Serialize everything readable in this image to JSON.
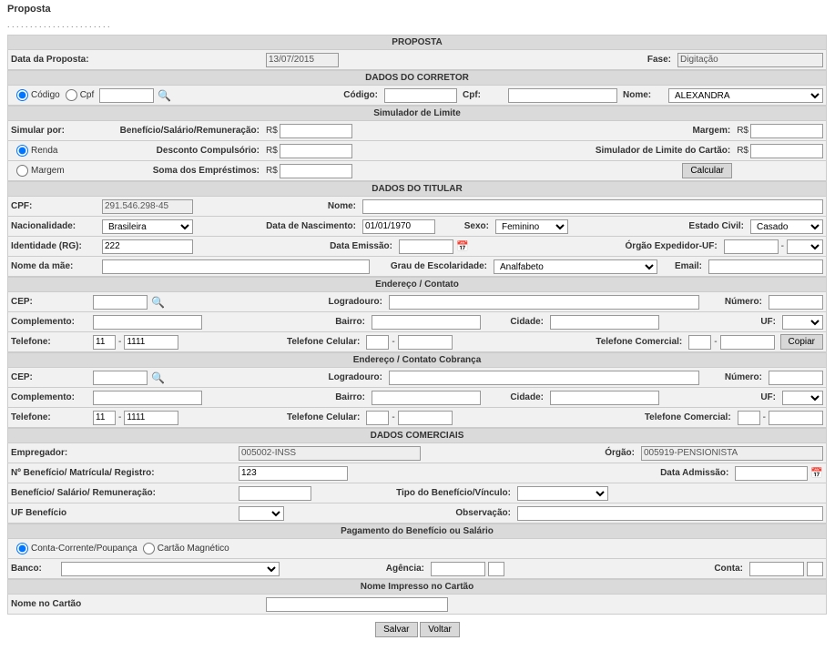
{
  "page": {
    "title": "Proposta",
    "breadcrumb": ". . . . . . . . . . . . . . . . . . . . . . ."
  },
  "proposta": {
    "header": "PROPOSTA",
    "data_label": "Data da Proposta:",
    "data_value": "13/07/2015",
    "fase_label": "Fase:",
    "fase_value": "Digitação"
  },
  "corretor": {
    "header": "DADOS DO CORRETOR",
    "radio_codigo": "Código",
    "radio_cpf": "Cpf",
    "codigo_label": "Código:",
    "codigo_value": "",
    "cpf_label": "Cpf:",
    "cpf_value": "",
    "nome_label": "Nome:",
    "nome_value": "ALEXANDRA"
  },
  "simulador": {
    "header": "Simulador de Limite",
    "simular_label": "Simular por:",
    "radio_renda": "Renda",
    "radio_margem": "Margem",
    "beneficio_label": "Benefício/Salário/Remuneração:",
    "beneficio_prefix": "R$",
    "beneficio_value": "",
    "desconto_label": "Desconto Compulsório:",
    "desconto_prefix": "R$",
    "desconto_value": "",
    "soma_label": "Soma dos Empréstimos:",
    "soma_prefix": "R$",
    "soma_value": "",
    "margem_label": "Margem:",
    "margem_prefix": "R$",
    "margem_value": "",
    "sim_cartao_label": "Simulador de Limite do Cartão:",
    "sim_cartao_prefix": "R$",
    "sim_cartao_value": "",
    "calcular_btn": "Calcular"
  },
  "titular": {
    "header": "DADOS DO TITULAR",
    "cpf_label": "CPF:",
    "cpf_value": "291.546.298-45",
    "nome_label": "Nome:",
    "nome_value": "",
    "nacionalidade_label": "Nacionalidade:",
    "nacionalidade_value": "Brasileira",
    "nascimento_label": "Data de Nascimento:",
    "nascimento_value": "01/01/1970",
    "sexo_label": "Sexo:",
    "sexo_value": "Feminino",
    "estadocivil_label": "Estado Civil:",
    "estadocivil_value": "Casado",
    "identidade_label": "Identidade (RG):",
    "identidade_value": "222",
    "emissao_label": "Data Emissão:",
    "emissao_value": "",
    "orgao_label": "Órgão Expedidor-UF:",
    "orgao_value": "",
    "orgao_uf": "",
    "mae_label": "Nome da mãe:",
    "mae_value": "",
    "escolaridade_label": "Grau de Escolaridade:",
    "escolaridade_value": "Analfabeto",
    "email_label": "Email:",
    "email_value": ""
  },
  "endereco": {
    "header": "Endereço / Contato",
    "cep_label": "CEP:",
    "cep_value": "",
    "logradouro_label": "Logradouro:",
    "logradouro_value": "",
    "numero_label": "Número:",
    "numero_value": "",
    "complemento_label": "Complemento:",
    "complemento_value": "",
    "bairro_label": "Bairro:",
    "bairro_value": "",
    "cidade_label": "Cidade:",
    "cidade_value": "",
    "uf_label": "UF:",
    "uf_value": "",
    "telefone_label": "Telefone:",
    "tel_ddd": "11",
    "tel_num": "1111",
    "telcel_label": "Telefone Celular:",
    "telcel_ddd": "",
    "telcel_num": "",
    "telcom_label": "Telefone Comercial:",
    "telcom_ddd": "",
    "telcom_num": "",
    "copiar_btn": "Copiar"
  },
  "endereco_cob": {
    "header": "Endereço / Contato Cobrança",
    "cep_label": "CEP:",
    "cep_value": "",
    "logradouro_label": "Logradouro:",
    "logradouro_value": "",
    "numero_label": "Número:",
    "numero_value": "",
    "complemento_label": "Complemento:",
    "complemento_value": "",
    "bairro_label": "Bairro:",
    "bairro_value": "",
    "cidade_label": "Cidade:",
    "cidade_value": "",
    "uf_label": "UF:",
    "uf_value": "",
    "telefone_label": "Telefone:",
    "tel_ddd": "11",
    "tel_num": "1111",
    "telcel_label": "Telefone Celular:",
    "telcel_ddd": "",
    "telcel_num": "",
    "telcom_label": "Telefone Comercial:",
    "telcom_ddd": "",
    "telcom_num": ""
  },
  "comerciais": {
    "header": "DADOS COMERCIAIS",
    "empregador_label": "Empregador:",
    "empregador_value": "005002-INSS",
    "orgao_label": "Órgão:",
    "orgao_value": "005919-PENSIONISTA",
    "beneficio_num_label": "Nº Benefício/ Matrícula/ Registro:",
    "beneficio_num_value": "123",
    "admissao_label": "Data Admissão:",
    "admissao_value": "",
    "remun_label": "Benefício/ Salário/ Remuneração:",
    "remun_value": "",
    "tipo_label": "Tipo do Benefício/Vínculo:",
    "tipo_value": "",
    "ufben_label": "UF Benefício",
    "ufben_value": "",
    "obs_label": "Observação:",
    "obs_value": ""
  },
  "pagamento": {
    "header": "Pagamento do Benefício  ou Salário",
    "radio_conta": "Conta-Corrente/Poupança",
    "radio_cartao": "Cartão Magnético",
    "banco_label": "Banco:",
    "banco_value": "",
    "agencia_label": "Agência:",
    "agencia_value": "",
    "agencia_dv": "",
    "conta_label": "Conta:",
    "conta_value": "",
    "conta_dv": ""
  },
  "cartao": {
    "header": "Nome Impresso no Cartão",
    "nome_label": "Nome no Cartão",
    "nome_value": ""
  },
  "footer": {
    "salvar": "Salvar",
    "voltar": "Voltar"
  }
}
